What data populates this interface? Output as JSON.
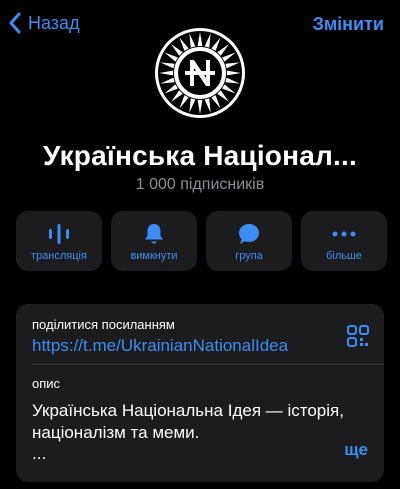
{
  "nav": {
    "back_label": "Назад",
    "edit_label": "Змінити"
  },
  "channel": {
    "title": "Українська Націонал...",
    "subscribers": "1 000 підписників"
  },
  "actions": [
    {
      "label": "трансляція",
      "icon": "broadcast-icon"
    },
    {
      "label": "вимкнути",
      "icon": "bell-icon"
    },
    {
      "label": "група",
      "icon": "chat-bubble-icon"
    },
    {
      "label": "більше",
      "icon": "more-dots-icon"
    }
  ],
  "share": {
    "label": "поділитися посиланням",
    "link": "https://t.me/UkrainianNationalIdea",
    "icon": "qr-code-icon"
  },
  "description": {
    "label": "опис",
    "text": "Українська Національна Ідея — історія, націоналізм та меми.",
    "ellipsis": "...",
    "more_label": "ще"
  },
  "colors": {
    "accent": "#3a8ef6",
    "background": "#000000",
    "card": "#1c1c1e",
    "secondary_text": "#8e8e93"
  }
}
